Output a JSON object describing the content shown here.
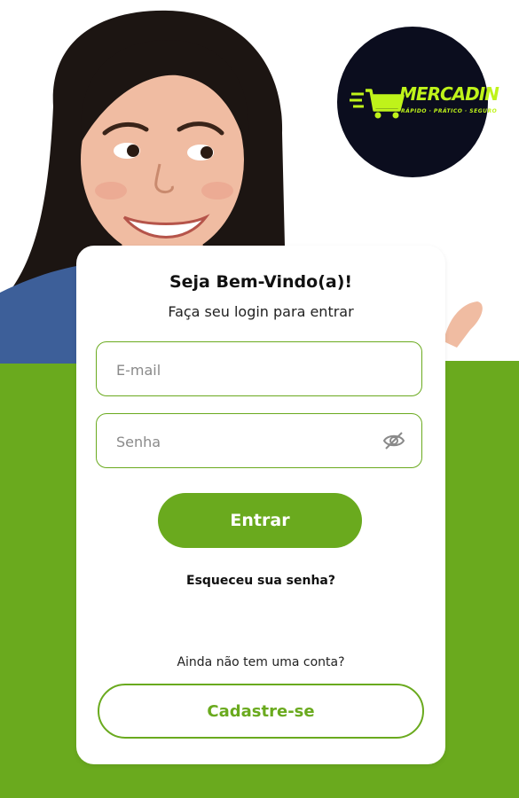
{
  "brand": {
    "name": "MERCADIN",
    "tagline": "RÁPIDO · PRÁTICO · SEGURO",
    "accent_color": "#6aaa1e",
    "logo_color": "#bff31a",
    "logo_bg": "#0b0d1e"
  },
  "login": {
    "title": "Seja Bem-Vindo(a)!",
    "subtitle": "Faça seu login para entrar",
    "email_placeholder": "E-mail",
    "password_placeholder": "Senha",
    "password_toggle_icon": "eye-off-icon",
    "submit_label": "Entrar",
    "forgot_label": "Esqueceu sua senha?"
  },
  "signup": {
    "prompt": "Ainda não tem uma conta?",
    "button_label": "Cadastre-se"
  }
}
